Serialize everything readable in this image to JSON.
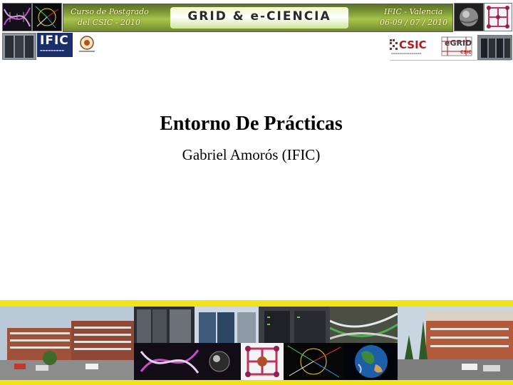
{
  "banner": {
    "left_line1": "Curso de Postgrado",
    "left_line2": "del CSIC - 2010",
    "title": "GRID & e-CIENCIA",
    "right_line1": "IFIC - Valencia",
    "right_line2": "06-09 / 07 / 2010"
  },
  "logos": {
    "ific": "IFIC",
    "csic": "CSIC",
    "egrid": "eGRID",
    "egrid_sub": "CSIC"
  },
  "slide": {
    "title": "Entorno De Prácticas",
    "author": "Gabriel Amorós (IFIC)"
  },
  "colors": {
    "accent_yellow": "#f2e21a",
    "banner_green": "#86a23a",
    "csic_red": "#b01a1a",
    "ific_blue": "#1a2f6a"
  }
}
